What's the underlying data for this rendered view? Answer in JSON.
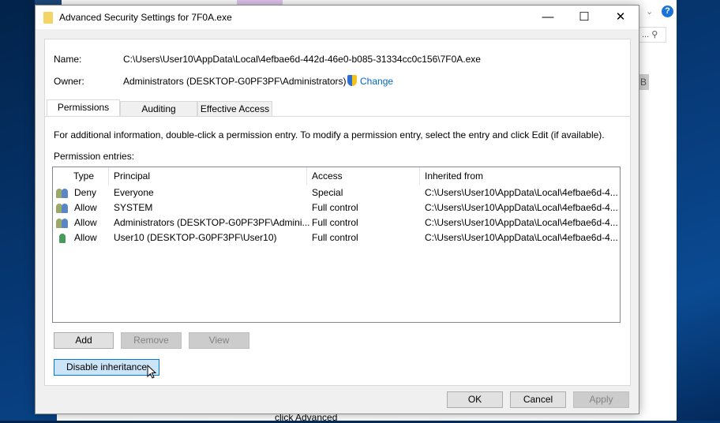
{
  "background": {
    "search_text": "...",
    "side_letter": "B",
    "bottom_text": "click Advanced"
  },
  "dialog": {
    "title": "Advanced Security Settings for 7F0A.exe",
    "name_label": "Name:",
    "name_value": "C:\\Users\\User10\\AppData\\Local\\4efbae6d-442d-46e0-b085-31334cc0c156\\7F0A.exe",
    "owner_label": "Owner:",
    "owner_value": "Administrators (DESKTOP-G0PF3PF\\Administrators)",
    "change_link": "Change",
    "tabs": [
      {
        "label": "Permissions",
        "active": true
      },
      {
        "label": "Auditing"
      },
      {
        "label": "Effective Access"
      }
    ],
    "info_text": "For additional information, double-click a permission entry. To modify a permission entry, select the entry and click Edit (if available).",
    "entries_label": "Permission entries:",
    "columns": [
      "Type",
      "Principal",
      "Access",
      "Inherited from"
    ],
    "rows": [
      {
        "icon": "group-users-icon",
        "type": "Deny",
        "principal": "Everyone",
        "access": "Special",
        "inherited": "C:\\Users\\User10\\AppData\\Local\\4efbae6d-4..."
      },
      {
        "icon": "group-users-icon",
        "type": "Allow",
        "principal": "SYSTEM",
        "access": "Full control",
        "inherited": "C:\\Users\\User10\\AppData\\Local\\4efbae6d-4..."
      },
      {
        "icon": "group-users-icon",
        "type": "Allow",
        "principal": "Administrators (DESKTOP-G0PF3PF\\Admini...",
        "access": "Full control",
        "inherited": "C:\\Users\\User10\\AppData\\Local\\4efbae6d-4..."
      },
      {
        "icon": "user-icon",
        "type": "Allow",
        "principal": "User10 (DESKTOP-G0PF3PF\\User10)",
        "access": "Full control",
        "inherited": "C:\\Users\\User10\\AppData\\Local\\4efbae6d-4..."
      }
    ],
    "buttons": {
      "add": "Add",
      "remove": "Remove",
      "view": "View",
      "disable_inheritance": "Disable inheritance",
      "ok": "OK",
      "cancel": "Cancel",
      "apply": "Apply"
    }
  }
}
